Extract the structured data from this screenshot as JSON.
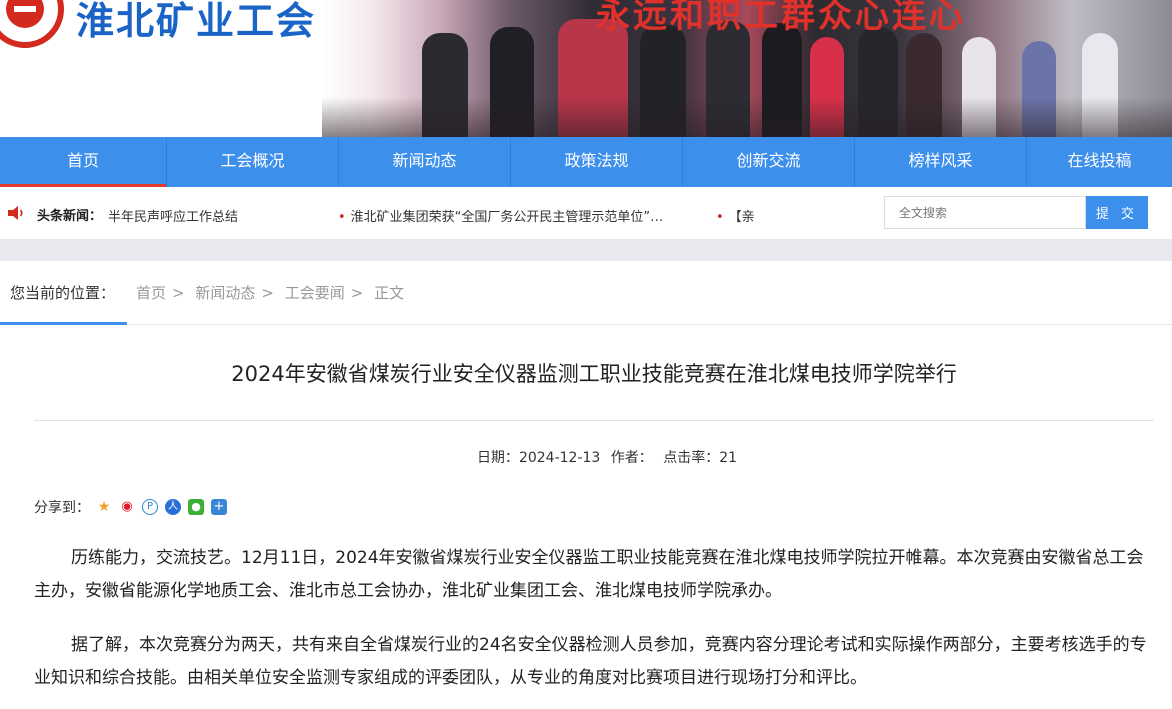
{
  "banner": {
    "logo_text": "淮北矿业工会",
    "slogan": "永远和职工群众心连心"
  },
  "nav": {
    "items": [
      "首页",
      "工会概况",
      "新闻动态",
      "政策法规",
      "创新交流",
      "榜样风采",
      "在线投稿"
    ],
    "active": "首页"
  },
  "ticker": {
    "label": "头条新闻：",
    "items": [
      "半年民声呼应工作总结",
      "淮北矿业集团荣获“全国厂务公开民主管理示范单位”…",
      "【亲"
    ]
  },
  "search": {
    "placeholder": "全文搜索",
    "button": "提 交"
  },
  "breadcrumb": {
    "where_label": "您当前的位置：",
    "items": [
      "首页",
      "新闻动态",
      "工会要闻",
      "正文"
    ]
  },
  "article": {
    "title": "2024年安徽省煤炭行业安全仪器监测工职业技能竞赛在淮北煤电技师学院举行",
    "date_label": "日期：",
    "date": "2024-12-13",
    "author_label": "作者：",
    "hits_label": "点击率：",
    "hits": "21",
    "share_label": "分享到：",
    "share_icons": [
      "qzone-icon",
      "weibo-icon",
      "pinterest-icon",
      "renren-icon",
      "wechat-icon",
      "more-share-icon"
    ],
    "paragraphs": [
      "历练能力，交流技艺。12月11日，2024年安徽省煤炭行业安全仪器监工职业技能竞赛在淮北煤电技师学院拉开帷幕。本次竞赛由安徽省总工会主办，安徽省能源化学地质工会、淮北市总工会协办，淮北矿业集团工会、淮北煤电技师学院承办。",
      "据了解，本次竞赛分为两天，共有来自全省煤炭行业的24名安全仪器检测人员参加，竞赛内容分理论考试和实际操作两部分，主要考核选手的专业知识和综合技能。由相关单位安全监测专家组成的评委团队，从专业的角度对比赛项目进行现场打分和评比。"
    ]
  },
  "colors": {
    "nav_blue": "#3d8fec",
    "accent_red": "#e33a2e",
    "logo_blue": "#1a64c8"
  }
}
